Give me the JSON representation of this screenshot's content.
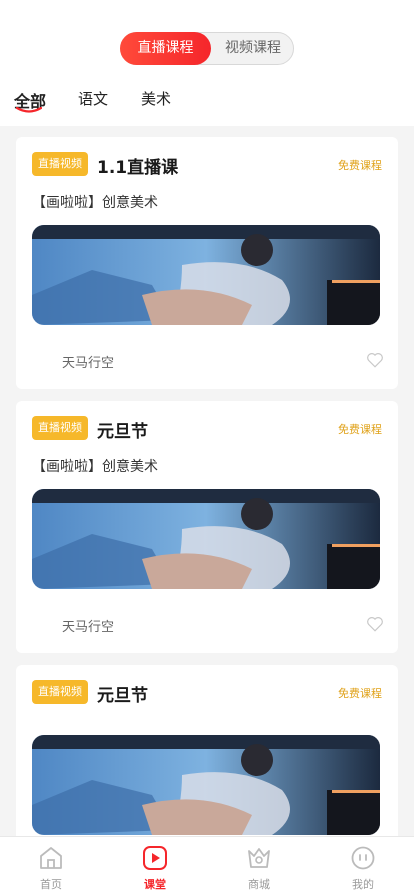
{
  "segments": {
    "live": "直播课程",
    "video": "视频课程"
  },
  "tabs": [
    "全部",
    "语文",
    "美术"
  ],
  "cards": [
    {
      "badge": "直播视频",
      "title": "1.1直播课",
      "tag": "免费课程",
      "subtitle": "【画啦啦】创意美术",
      "author": "天马行空"
    },
    {
      "badge": "直播视频",
      "title": "元旦节",
      "tag": "免费课程",
      "subtitle": "【画啦啦】创意美术",
      "author": "天马行空"
    },
    {
      "badge": "直播视频",
      "title": "元旦节",
      "tag": "免费课程"
    }
  ],
  "tabbar": [
    {
      "label": "首页",
      "icon": "home-icon"
    },
    {
      "label": "课堂",
      "icon": "play-icon"
    },
    {
      "label": "商城",
      "icon": "shop-icon"
    },
    {
      "label": "我的",
      "icon": "profile-icon"
    }
  ],
  "colors": {
    "accent": "#f5262b",
    "badge": "#f6b82a",
    "tag": "#e0a21a"
  }
}
